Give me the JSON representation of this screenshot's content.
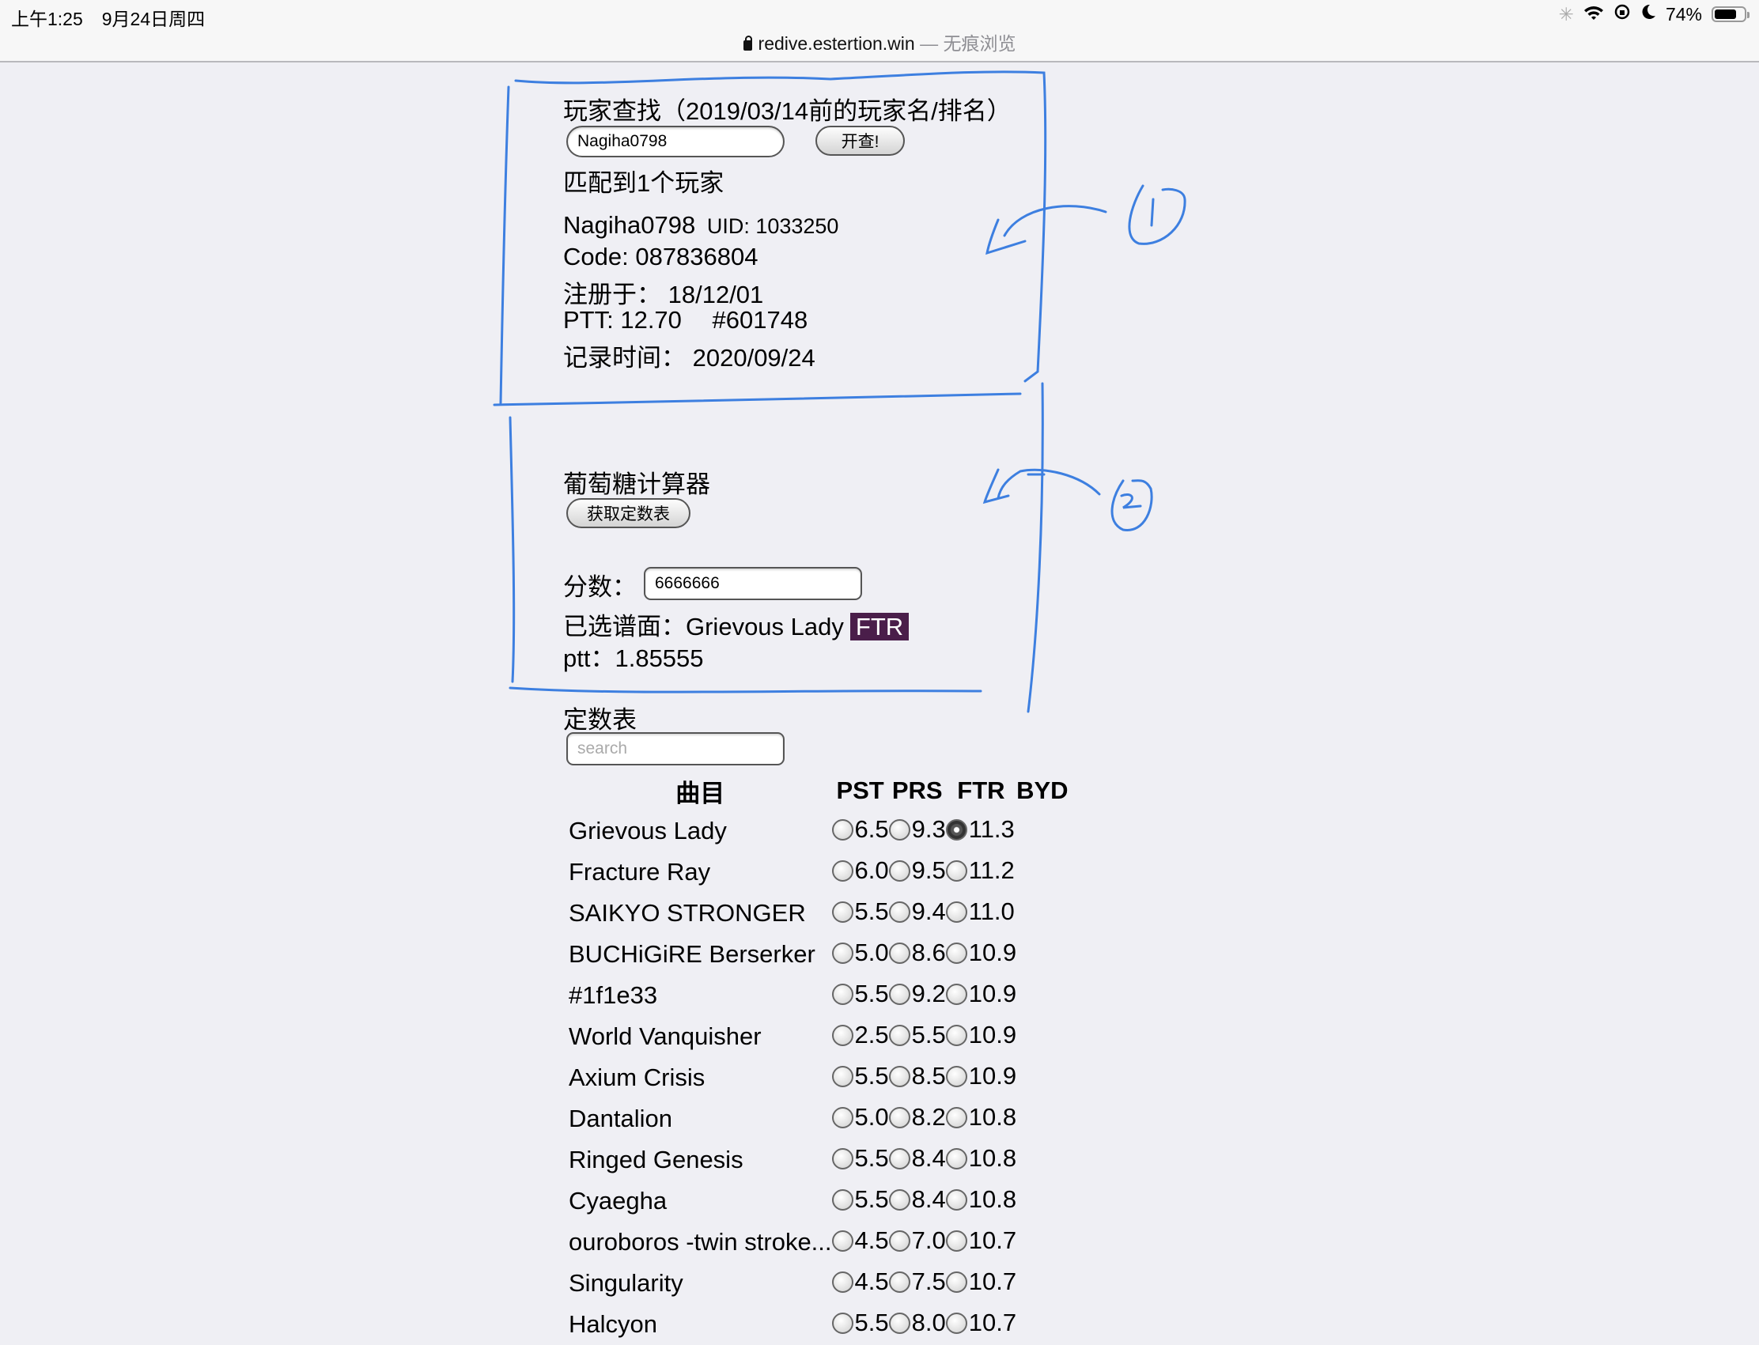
{
  "status_bar": {
    "time": "上午1:25",
    "date": "9月24日周四",
    "battery": "74%",
    "battery_level": 0.74
  },
  "browser": {
    "url": "redive.estertion.win",
    "mode": "— 无痕浏览"
  },
  "player_search": {
    "title": "玩家查找（2019/03/14前的玩家名/排名）",
    "input_value": "Nagiha0798",
    "button_label": "开查!",
    "match_text": "匹配到1个玩家",
    "player_name": "Nagiha0798",
    "uid": "UID: 1033250",
    "code": "Code: 087836804",
    "registered": "注册于：  18/12/01",
    "ptt": "PTT: 12.70",
    "rank": "#601748",
    "record_time": "记录时间：  2020/09/24"
  },
  "calculator": {
    "title": "葡萄糖计算器",
    "fetch_button": "获取定数表",
    "score_label": "分数：",
    "score_value": "6666666",
    "selected_label": "已选谱面：",
    "selected_song": "Grievous Lady",
    "selected_diff": "FTR",
    "ptt_label": "ptt：",
    "ptt_value": "1.85555"
  },
  "constants_table": {
    "title": "定数表",
    "search_placeholder": "search",
    "headers": [
      "曲目",
      "PST",
      "PRS",
      "FTR",
      "BYD"
    ],
    "selected": {
      "row": 0,
      "col": "FTR"
    },
    "rows": [
      {
        "song": "Grievous Lady",
        "pst": "6.5",
        "prs": "9.3",
        "ftr": "11.3"
      },
      {
        "song": "Fracture Ray",
        "pst": "6.0",
        "prs": "9.5",
        "ftr": "11.2"
      },
      {
        "song": "SAIKYO STRONGER",
        "pst": "5.5",
        "prs": "9.4",
        "ftr": "11.0"
      },
      {
        "song": "BUCHiGiRE Berserker",
        "pst": "5.0",
        "prs": "8.6",
        "ftr": "10.9"
      },
      {
        "song": "#1f1e33",
        "pst": "5.5",
        "prs": "9.2",
        "ftr": "10.9"
      },
      {
        "song": "World Vanquisher",
        "pst": "2.5",
        "prs": "5.5",
        "ftr": "10.9"
      },
      {
        "song": "Axium Crisis",
        "pst": "5.5",
        "prs": "8.5",
        "ftr": "10.9"
      },
      {
        "song": "Dantalion",
        "pst": "5.0",
        "prs": "8.2",
        "ftr": "10.8"
      },
      {
        "song": "Ringed Genesis",
        "pst": "5.5",
        "prs": "8.4",
        "ftr": "10.8"
      },
      {
        "song": "Cyaegha",
        "pst": "5.5",
        "prs": "8.4",
        "ftr": "10.8"
      },
      {
        "song": "ouroboros -twin stroke...",
        "pst": "4.5",
        "prs": "7.0",
        "ftr": "10.7"
      },
      {
        "song": "Singularity",
        "pst": "4.5",
        "prs": "7.5",
        "ftr": "10.7"
      },
      {
        "song": "Halcyon",
        "pst": "5.5",
        "prs": "8.0",
        "ftr": "10.7"
      }
    ]
  },
  "annotations": {
    "label_1": "1",
    "label_2": "2",
    "color": "#3d7fe0"
  }
}
